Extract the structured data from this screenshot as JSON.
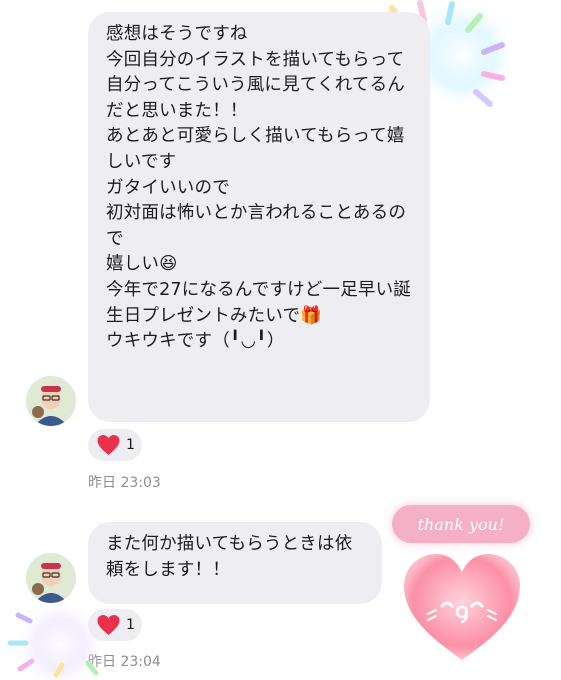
{
  "messages": [
    {
      "text": "感想はそうですね\n今回自分のイラストを描いてもらって自分ってこういう風に見てくれてるんだと思いまた！！\nあとあと可愛らしく描いてもらって嬉しいです\nガタイいいので\n初対面は怖いとか言われることあるので\n嬉しい😆\n今年で27になるんですけど一足早い誕生日プレゼントみたいで🎁\nウキウキです（╹◡╹）",
      "reaction_count": "1",
      "time": "昨日 23:03"
    },
    {
      "text": "また何か描いてもらうときは依頼をします！！",
      "reaction_count": "1",
      "time": "昨日 23:04"
    }
  ],
  "stickers": {
    "thank_you": "thank you!"
  },
  "colors": {
    "bubble": "#eeedf2",
    "heart": "#e8314c",
    "timestamp": "#8e8e93",
    "sticker_pink": "#f6a8bf"
  }
}
